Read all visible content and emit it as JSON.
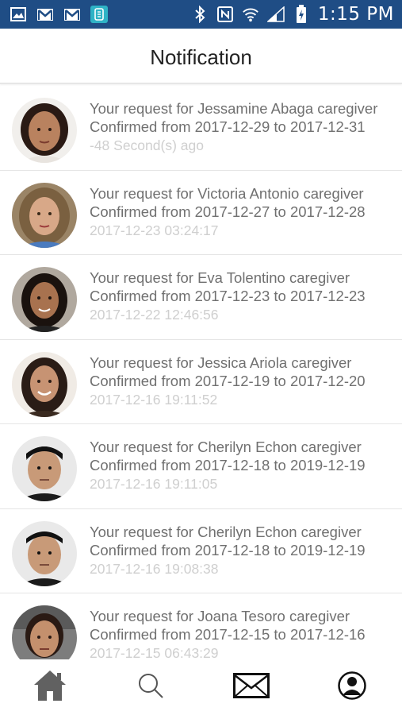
{
  "status_bar": {
    "time": "1:15 PM",
    "left_icons": [
      "gallery-icon",
      "gmail-icon",
      "gmail-icon",
      "app-icon"
    ],
    "right_icons": [
      "bluetooth-icon",
      "nfc-icon",
      "wifi-icon",
      "signal-icon",
      "battery-charging-icon"
    ],
    "background": "#1f4d85"
  },
  "header": {
    "title": "Notification"
  },
  "notifications": [
    {
      "line1": "Your request for Jessamine Abaga caregiver",
      "line2": "Confirmed from 2017-12-29 to 2017-12-31",
      "time": "-48 Second(s) ago"
    },
    {
      "line1": "Your request for Victoria Antonio caregiver",
      "line2": "Confirmed from 2017-12-27 to 2017-12-28",
      "time": "2017-12-23 03:24:17"
    },
    {
      "line1": "Your request for Eva Tolentino caregiver",
      "line2": "Confirmed from 2017-12-23 to 2017-12-23",
      "time": "2017-12-22 12:46:56"
    },
    {
      "line1": "Your request for Jessica  Ariola caregiver",
      "line2": "Confirmed from 2017-12-19 to 2017-12-20",
      "time": "2017-12-16 19:11:52"
    },
    {
      "line1": "Your request for Cherilyn Echon caregiver",
      "line2": "Confirmed from 2017-12-18 to 2019-12-19",
      "time": "2017-12-16 19:11:05"
    },
    {
      "line1": "Your request for Cherilyn Echon caregiver",
      "line2": "Confirmed from 2017-12-18 to 2019-12-19",
      "time": "2017-12-16 19:08:38"
    },
    {
      "line1": "Your request for Joana Tesoro caregiver",
      "line2": "Confirmed from 2017-12-15 to 2017-12-16",
      "time": "2017-12-15 06:43:29"
    }
  ],
  "bottom_nav": {
    "items": [
      "home-icon",
      "search-icon",
      "mail-icon",
      "profile-icon"
    ],
    "active": "home-icon"
  },
  "colors": {
    "primary_text": "#707070",
    "timestamp_text": "#cfcfcf",
    "divider": "#e5e5e5"
  }
}
